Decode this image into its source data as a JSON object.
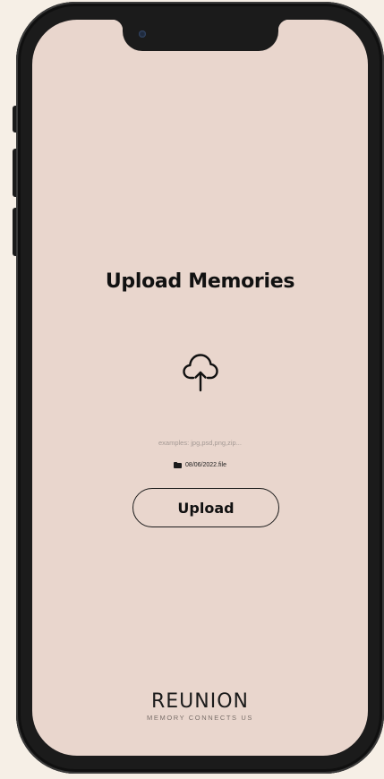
{
  "page": {
    "title": "Upload Memories",
    "examples_text": "examples: jpg,psd,png,zip...",
    "file_name": "08/06/2022.file",
    "upload_label": "Upload"
  },
  "brand": {
    "logo_text": "REUNION",
    "tagline": "MEMORY CONNECTS US"
  },
  "icons": {
    "upload": "cloud-upload-icon",
    "folder": "folder-icon"
  },
  "colors": {
    "screen_bg": "#e9d6cd",
    "page_bg": "#f6efe6",
    "frame": "#1b1b1b",
    "text": "#111111",
    "muted": "#a59a95"
  }
}
